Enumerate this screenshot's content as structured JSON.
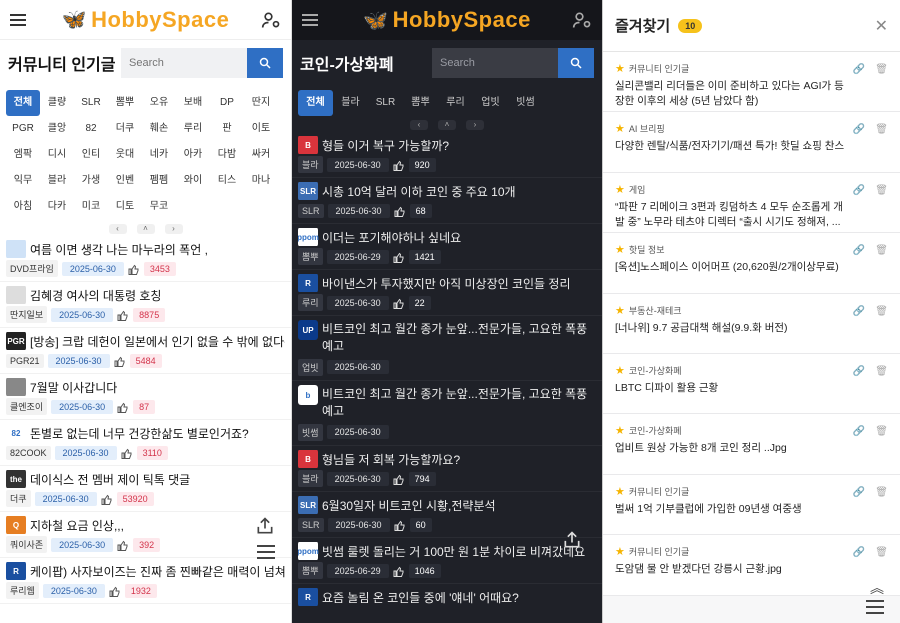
{
  "panel1": {
    "brand": "HobbySpace",
    "title": "커뮤니티 인기글",
    "search_placeholder": "Search",
    "tags": [
      "전체",
      "클량",
      "SLR",
      "뽐뿌",
      "오유",
      "보배",
      "DP",
      "딴지",
      "PGR",
      "클앙",
      "82",
      "더쿠",
      "훼손",
      "루리",
      "판",
      "이토",
      "엠팍",
      "디시",
      "인티",
      "웃대",
      "네카",
      "아카",
      "다밤",
      "싸커",
      "익무",
      "블라",
      "가생",
      "인벤",
      "펨펨",
      "와이",
      "티스",
      "마나",
      "아침",
      "다카",
      "미코",
      "디토",
      "무코"
    ],
    "active_tag": "전체",
    "posts": [
      {
        "title": "여름 이면 생각 나는 마누라의 폭언 ,",
        "src": "DVD프라임",
        "date": "2025-06-30",
        "count": "3453",
        "thumb": "#cfe2f7",
        "thumb_text": ""
      },
      {
        "title": "김혜경 여사의 대통령 호칭",
        "src": "딴지일보",
        "date": "2025-06-30",
        "count": "8875",
        "thumb": "#ddd",
        "thumb_text": ""
      },
      {
        "title": "[방송] 크랍 데헌이 일본에서 인기 없을 수 밖에 없다는",
        "src": "PGR21",
        "date": "2025-06-30",
        "count": "5484",
        "thumb": "#222",
        "thumb_text": "PGR"
      },
      {
        "title": "7월말 이사갑니다",
        "src": "클엔조이",
        "date": "2025-06-30",
        "count": "87",
        "thumb": "#888",
        "thumb_text": ""
      },
      {
        "title": "돈별로 없는데 너무 건강한삶도 별로인거죠?",
        "src": "82COOK",
        "date": "2025-06-30",
        "count": "3110",
        "thumb": "#fff",
        "thumb_text": "82"
      },
      {
        "title": "데이식스 전 멤버 제이 틱톡 댓글",
        "src": "더쿠",
        "date": "2025-06-30",
        "count": "53920",
        "thumb": "#333",
        "thumb_text": "the"
      },
      {
        "title": "지하철 요금 인상,,,",
        "src": "쿼이사존",
        "date": "2025-06-30",
        "count": "392",
        "thumb": "#e67e22",
        "thumb_text": "Q"
      },
      {
        "title": "케이팝) 사자보이즈는 진짜 좀 찐빠같은 매력이 넘쳐흐",
        "src": "루리웹",
        "date": "2025-06-30",
        "count": "1932",
        "thumb": "#1a4fa0",
        "thumb_text": "R"
      }
    ]
  },
  "panel2": {
    "brand": "HobbySpace",
    "title": "코인-가상화폐",
    "search_placeholder": "Search",
    "tags": [
      "전체",
      "블라",
      "SLR",
      "뽐뿌",
      "루리",
      "업빗",
      "빗썸"
    ],
    "active_tag": "전체",
    "posts": [
      {
        "title": "형들 이거 복구 가능할까?",
        "src": "블라",
        "date": "2025-06-30",
        "count": "920",
        "thumb": "#d9343c",
        "thumb_text": "B",
        "two_line": false
      },
      {
        "title": "시총 10억 달러 이하 코인 중 주요 10개",
        "src": "SLR",
        "date": "2025-06-30",
        "count": "68",
        "thumb": "#3b6db3",
        "thumb_text": "SLR",
        "two_line": false
      },
      {
        "title": "이더는 포기해야하나 싶네요",
        "src": "뽐뿌",
        "date": "2025-06-29",
        "count": "1421",
        "thumb": "#fff",
        "thumb_text": "ppom",
        "two_line": false
      },
      {
        "title": "바이낸스가 투자했지만 아직 미상장인 코인들 정리",
        "src": "루리",
        "date": "2025-06-30",
        "count": "22",
        "thumb": "#1a4fa0",
        "thumb_text": "R",
        "two_line": false
      },
      {
        "title": "비트코인 최고 월간 종가 눈앞...전문가들, 고요한 폭풍 예고",
        "src": "업빗",
        "date": "2025-06-30",
        "count": "",
        "thumb": "#0b3a8a",
        "thumb_text": "UP",
        "two_line": true
      },
      {
        "title": "비트코인 최고 월간 종가 눈앞...전문가들, 고요한 폭풍 예고",
        "src": "빗썸",
        "date": "2025-06-30",
        "count": "",
        "thumb": "#fff",
        "thumb_text": "b",
        "two_line": true
      },
      {
        "title": "형님들 저 회복 가능할까요?",
        "src": "블라",
        "date": "2025-06-30",
        "count": "794",
        "thumb": "#d9343c",
        "thumb_text": "B",
        "two_line": false
      },
      {
        "title": "6월30일자 비트코인 시황,전략분석",
        "src": "SLR",
        "date": "2025-06-30",
        "count": "60",
        "thumb": "#3b6db3",
        "thumb_text": "SLR",
        "two_line": false
      },
      {
        "title": "빗썸 룰렛 돌리는 거 100만 원 1분 차이로 비껴갔네요",
        "src": "뽐뿌",
        "date": "2025-06-29",
        "count": "1046",
        "thumb": "#fff",
        "thumb_text": "ppom",
        "two_line": false
      },
      {
        "title": "요즘 놀림 온 코인들 중에 '얘네' 어때요?",
        "src": "",
        "date": "",
        "count": "",
        "thumb": "#1a4fa0",
        "thumb_text": "R",
        "two_line": false
      }
    ]
  },
  "panel3": {
    "title": "즐겨찾기",
    "badge": "10",
    "items": [
      {
        "cat": "커뮤니티 인기글",
        "text": "실리콘밸리 리더들은 이미 준비하고 있다는 AGI가 등장한 이후의 세상 (5년 남았다 함)"
      },
      {
        "cat": "AI 브리핑",
        "text": "다양한 렌탈/식품/전자기기/패션 특가! 핫딜 쇼핑 찬스"
      },
      {
        "cat": "게임",
        "text": "“파판 7 리메이크 3편과 킹덤하츠 4 모두 순조롭게 개발 중” 노무라 테츠야 디렉터 “출시 시기도 정해져, ..."
      },
      {
        "cat": "핫딜 정보",
        "text": "[옥션]노스페이스 이어머프 (20,620원/2개이상무료)"
      },
      {
        "cat": "부동산-재테크",
        "text": "[너나위] 9.7 공급대책 해설(9.9.화 버전)"
      },
      {
        "cat": "코인-가상화폐",
        "text": "LBTC 디파이 활용 근황"
      },
      {
        "cat": "코인-가상화폐",
        "text": "업비트 원상 가능한 8개 코인 정리 ..Jpg"
      },
      {
        "cat": "커뮤니티 인기글",
        "text": "벌써 1억 기부클럽에 가입한 09년생 여중생"
      },
      {
        "cat": "커뮤니티 인기글",
        "text": "도암댐 물 안 받겠다던 강릉시 근황.jpg"
      }
    ]
  },
  "colors": {
    "accent": "#2f6fc4",
    "brand": "#f5a623",
    "count_red": "#d3344b",
    "star": "#f5b400"
  }
}
